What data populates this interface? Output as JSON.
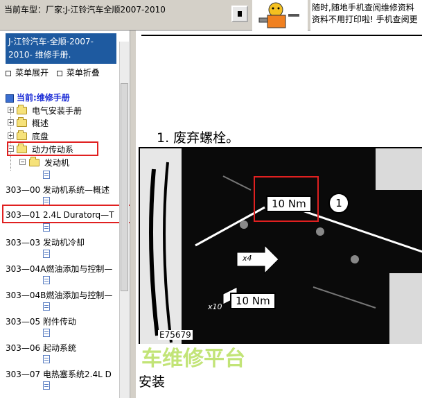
{
  "topbar": {
    "title": "当前车型：厂家:J-江铃汽车全顺2007-2010",
    "ad_line1": "随时,随地手机查阅维修资料",
    "ad_line2": "资料不用打印啦! 手机查阅更"
  },
  "sidebar": {
    "manual_title": "J-江铃汽车-全顺-2007-2010- 维修手册.",
    "expand_label": "菜单展开",
    "collapse_label": "菜单折叠",
    "current_label": "当前:维修手册",
    "tree": [
      {
        "label": "电气安装手册"
      },
      {
        "label": "概述"
      },
      {
        "label": "底盘"
      },
      {
        "label": "动力传动系"
      },
      {
        "label": "发动机"
      }
    ],
    "docs": [
      {
        "label": "303—00 发动机系统—概述"
      },
      {
        "label": "303—01 2.4L Duratorq—T"
      },
      {
        "label": "303—03 发动机冷却"
      },
      {
        "label": "303—04A燃油添加与控制—"
      },
      {
        "label": "303—04B燃油添加与控制—"
      },
      {
        "label": "303—05 附件传动"
      },
      {
        "label": "303—06 起动系统"
      },
      {
        "label": "303—07 电热塞系统2.4L D"
      }
    ]
  },
  "content": {
    "step": "1.  废弃螺栓。",
    "figure": {
      "torque1": "10 Nm",
      "callout1": "1",
      "qty_x4": "x4",
      "qty_x10": "x10",
      "torque2": "10 Nm",
      "code": "E75679"
    },
    "watermark": "车维修平台",
    "install": "安装"
  }
}
